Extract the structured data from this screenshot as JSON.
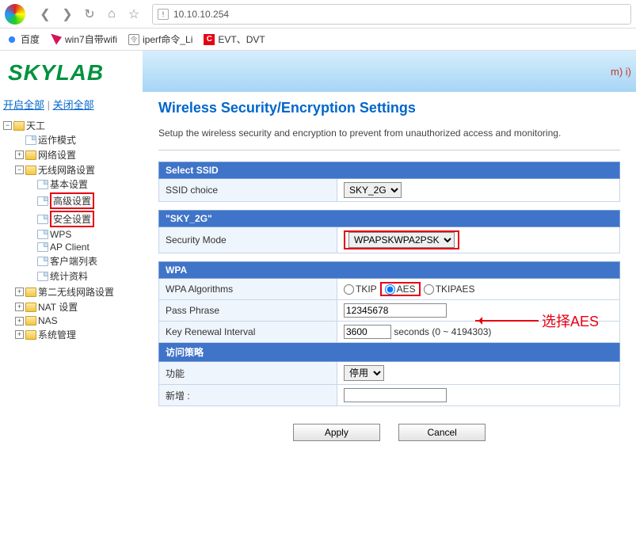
{
  "browser": {
    "url": "10.10.10.254",
    "bookmarks": {
      "baidu": "百度",
      "win7": "win7自带wifi",
      "iperf": "iperf命令_Li",
      "evt": "EVT、DVT"
    }
  },
  "sidebar": {
    "logo": "SKYLAB",
    "open_all": "开启全部",
    "close_all": "关闭全部",
    "root": "天工",
    "items": {
      "op_mode": "运作模式",
      "net": "网络设置",
      "wlan": "无线网路设置",
      "wlan_children": {
        "basic": "基本设置",
        "adv": "高级设置",
        "sec": "安全设置",
        "wps": "WPS",
        "apclient": "AP Client",
        "clients": "客户端列表",
        "stats": "统计资料"
      },
      "wlan2": "第二无线网路设置",
      "nat": "NAT 设置",
      "nas": "NAS",
      "sys": "系统管理"
    }
  },
  "banner": {
    "text": "m) i)"
  },
  "page": {
    "title": "Wireless Security/Encryption Settings",
    "desc": "Setup the wireless security and encryption to prevent from unauthorized access and monitoring."
  },
  "ssid_panel": {
    "header": "Select SSID",
    "choice_label": "SSID choice",
    "choice_value": "SKY_2G"
  },
  "sec_panel": {
    "header": "\"SKY_2G\"",
    "mode_label": "Security Mode",
    "mode_value": "WPAPSKWPA2PSK"
  },
  "wpa_panel": {
    "header": "WPA",
    "algo_label": "WPA Algorithms",
    "algo": {
      "tkip": "TKIP",
      "aes": "AES",
      "tkipaes": "TKIPAES"
    },
    "pass_label": "Pass Phrase",
    "pass_value": "12345678",
    "key_label": "Key Renewal Interval",
    "key_value": "3600",
    "key_hint": "seconds   (0 ~ 4194303)"
  },
  "acc_panel": {
    "header": "访问策略",
    "func_label": "功能",
    "func_value": "停用",
    "add_label": "新增 :"
  },
  "buttons": {
    "apply": "Apply",
    "cancel": "Cancel"
  },
  "annot": {
    "aes": "选择AES"
  }
}
